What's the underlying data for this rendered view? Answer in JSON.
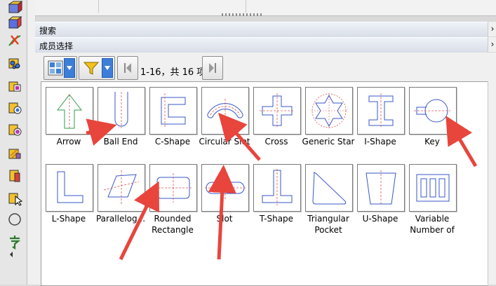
{
  "sections": {
    "search_title": "搜索",
    "members_title": "成员选择"
  },
  "toolbar": {
    "range_text": "1-16，共 16 项"
  },
  "library": {
    "items": [
      {
        "label": "Arrow"
      },
      {
        "label": "Ball End"
      },
      {
        "label": "C-Shape"
      },
      {
        "label": "Circular Slot"
      },
      {
        "label": "Cross"
      },
      {
        "label": "Generic Star"
      },
      {
        "label": "I-Shape"
      },
      {
        "label": "Key"
      },
      {
        "label": "L-Shape"
      },
      {
        "label": "Parallelog..."
      },
      {
        "label": "Rounded Rectangle"
      },
      {
        "label": "Slot"
      },
      {
        "label": "T-Shape"
      },
      {
        "label": "Triangular Pocket"
      },
      {
        "label": "U-Shape"
      },
      {
        "label": "Variable Number of"
      }
    ]
  },
  "colors": {
    "arrow": "#e8453c",
    "shape_outline": "#3a57c8",
    "centerline": "#d9534f",
    "arrow_icon_outline": "#2e9e4a"
  }
}
